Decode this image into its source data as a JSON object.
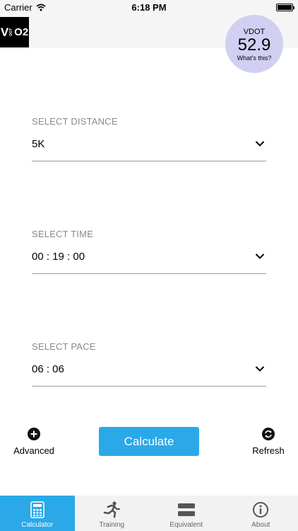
{
  "status_bar": {
    "carrier": "Carrier",
    "time": "6:18 PM"
  },
  "logo": {
    "v": "V",
    "dot": "DOT",
    "o2": "O2"
  },
  "vdot": {
    "label": "VDOT",
    "value": "52.9",
    "help": "What's this?"
  },
  "distance": {
    "label": "SELECT DISTANCE",
    "value": "5K"
  },
  "time": {
    "label": "SELECT TIME",
    "value": "00 : 19 : 00"
  },
  "pace": {
    "label": "SELECT PACE",
    "value": "06 : 06"
  },
  "actions": {
    "advanced": "Advanced",
    "calculate": "Calculate",
    "refresh": "Refresh"
  },
  "tabs": [
    {
      "label": "Calculator",
      "icon": "calculator-icon",
      "active": true
    },
    {
      "label": "Training",
      "icon": "runner-icon",
      "active": false
    },
    {
      "label": "Equivalent",
      "icon": "equal-icon",
      "active": false
    },
    {
      "label": "About",
      "icon": "info-icon",
      "active": false
    }
  ],
  "colors": {
    "accent": "#2ba8e8",
    "badge": "#d2d0f2",
    "tab_bar": "#f2f2f2"
  }
}
